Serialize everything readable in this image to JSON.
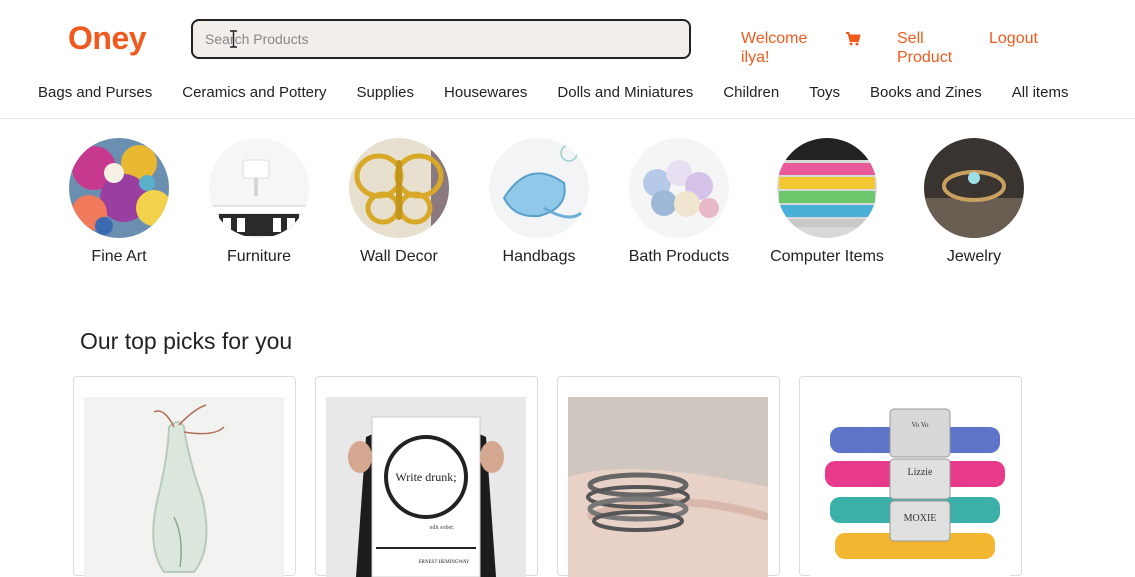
{
  "header": {
    "logo": "Oney",
    "search_placeholder": "Search Products",
    "welcome": "Welcome ilya!",
    "cart_icon": "shopping-cart-icon",
    "sell": "Sell Product",
    "logout": "Logout",
    "accent": "#f15a1e"
  },
  "categories": [
    "Bags and Purses",
    "Ceramics and Pottery",
    "Supplies",
    "Housewares",
    "Dolls and Miniatures",
    "Children",
    "Toys",
    "Books and Zines",
    "All items"
  ],
  "featured": [
    {
      "label": "Fine Art"
    },
    {
      "label": "Furniture"
    },
    {
      "label": "Wall Decor"
    },
    {
      "label": "Handbags"
    },
    {
      "label": "Bath Products"
    },
    {
      "label": "Computer Items"
    },
    {
      "label": "Jewelry"
    }
  ],
  "picks": {
    "title": "Our top picks for you",
    "poster_text": "Write drunk;",
    "poster_sub": "edit sober.",
    "poster_credit": "ERNEST HEMINGWAY",
    "collar_names": [
      "Vo Vo",
      "Lizzie",
      "MOXIE"
    ]
  }
}
